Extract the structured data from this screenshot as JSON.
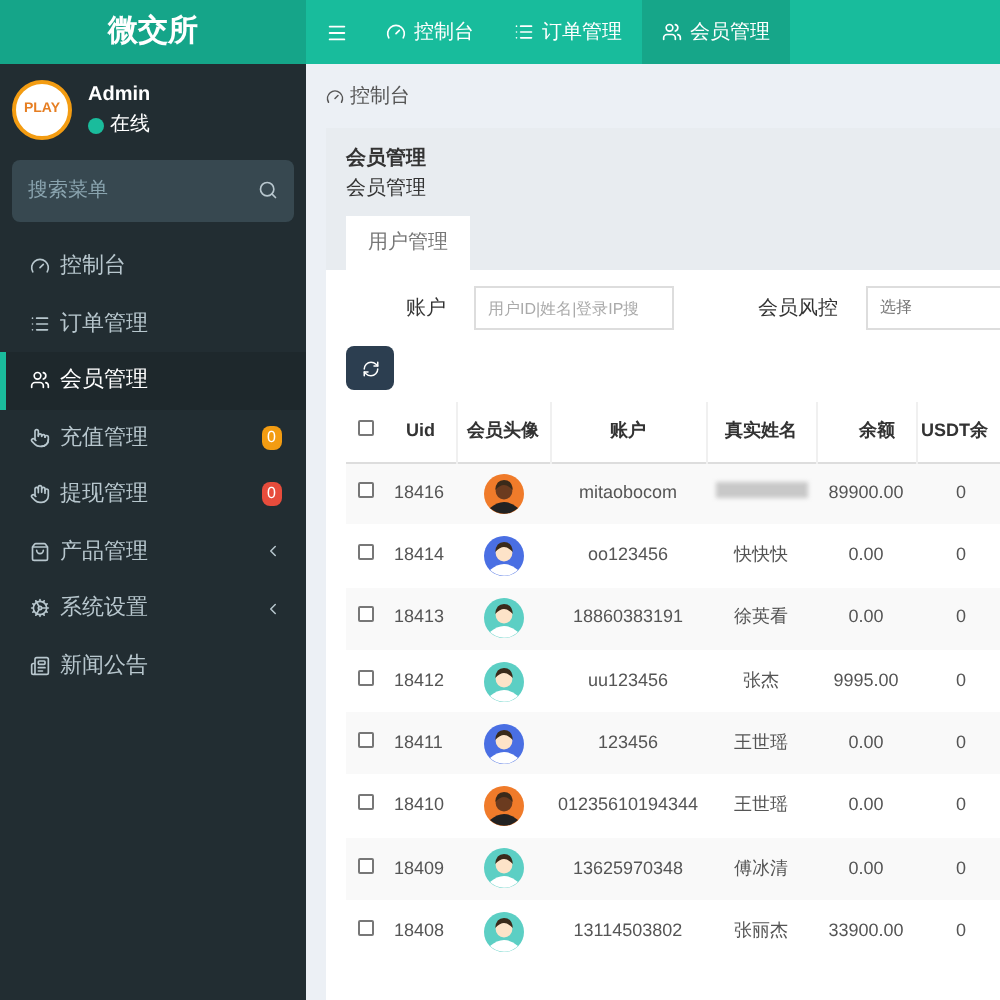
{
  "brand": "微交所",
  "user": {
    "name": "Admin",
    "avatar_text": "PLAY",
    "status": "在线",
    "online": true
  },
  "search": {
    "placeholder": "搜索菜单"
  },
  "sidebar": {
    "items": [
      {
        "label": "控制台",
        "kind": "dashboard",
        "selected": false
      },
      {
        "label": "订单管理",
        "kind": "list",
        "selected": false
      },
      {
        "label": "会员管理",
        "kind": "users",
        "selected": true
      },
      {
        "label": "充值管理",
        "kind": "recharge",
        "selected": false,
        "badge": {
          "text": "0",
          "color": "#f39c12"
        }
      },
      {
        "label": "提现管理",
        "kind": "withdraw",
        "selected": false,
        "badge": {
          "text": "0",
          "color": "#e74c3c"
        }
      },
      {
        "label": "产品管理",
        "kind": "products",
        "selected": false,
        "submenu": true
      },
      {
        "label": "系统设置",
        "kind": "settings",
        "selected": false,
        "submenu": true
      },
      {
        "label": "新闻公告",
        "kind": "news",
        "selected": false
      }
    ]
  },
  "top_nav": {
    "tabs": [
      {
        "label": "控制台",
        "kind": "dashboard",
        "selected": false
      },
      {
        "label": "订单管理",
        "kind": "list",
        "selected": false
      },
      {
        "label": "会员管理",
        "kind": "users",
        "selected": true
      }
    ]
  },
  "breadcrumb": "控制台",
  "panel": {
    "title": "会员管理",
    "subtitle": "会员管理",
    "tabs": [
      {
        "label": "用户管理",
        "selected": true
      }
    ],
    "filters": [
      {
        "label": "账户",
        "kind": "input",
        "placeholder": "用户ID|姓名|登录IP搜"
      },
      {
        "label": "会员风控",
        "kind": "select",
        "placeholder": "选择"
      }
    ]
  },
  "table": {
    "all_checked": false,
    "columns": [
      "Uid",
      "会员头像",
      "账户",
      "真实姓名",
      "余额",
      "USDT余"
    ],
    "rows": [
      {
        "uid": "18416",
        "kind": "dark",
        "account": "mitaobocom",
        "real_name_hidden": true,
        "balance": "89900.00",
        "usdt": "0",
        "checked": false
      },
      {
        "uid": "18414",
        "kind": "blue",
        "account": "oo123456",
        "real_name": "快快快",
        "balance": "0.00",
        "usdt": "0",
        "checked": false
      },
      {
        "uid": "18413",
        "kind": "teal",
        "account": "18860383191",
        "real_name": "徐英看",
        "balance": "0.00",
        "usdt": "0",
        "checked": false
      },
      {
        "uid": "18412",
        "kind": "teal",
        "account": "uu123456",
        "real_name": "张杰",
        "balance": "9995.00",
        "usdt": "0",
        "checked": false
      },
      {
        "uid": "18411",
        "kind": "blue",
        "account": "123456",
        "real_name": "王世瑶",
        "balance": "0.00",
        "usdt": "0",
        "checked": false
      },
      {
        "uid": "18410",
        "kind": "dark",
        "account": "01235610194344",
        "real_name": "王世瑶",
        "balance": "0.00",
        "usdt": "0",
        "checked": false
      },
      {
        "uid": "18409",
        "kind": "teal",
        "account": "13625970348",
        "real_name": "傅冰清",
        "balance": "0.00",
        "usdt": "0",
        "checked": false
      },
      {
        "uid": "18408",
        "kind": "teal",
        "account": "13114503802",
        "real_name": "张丽杰",
        "balance": "33900.00",
        "usdt": "0",
        "checked": false
      }
    ]
  }
}
